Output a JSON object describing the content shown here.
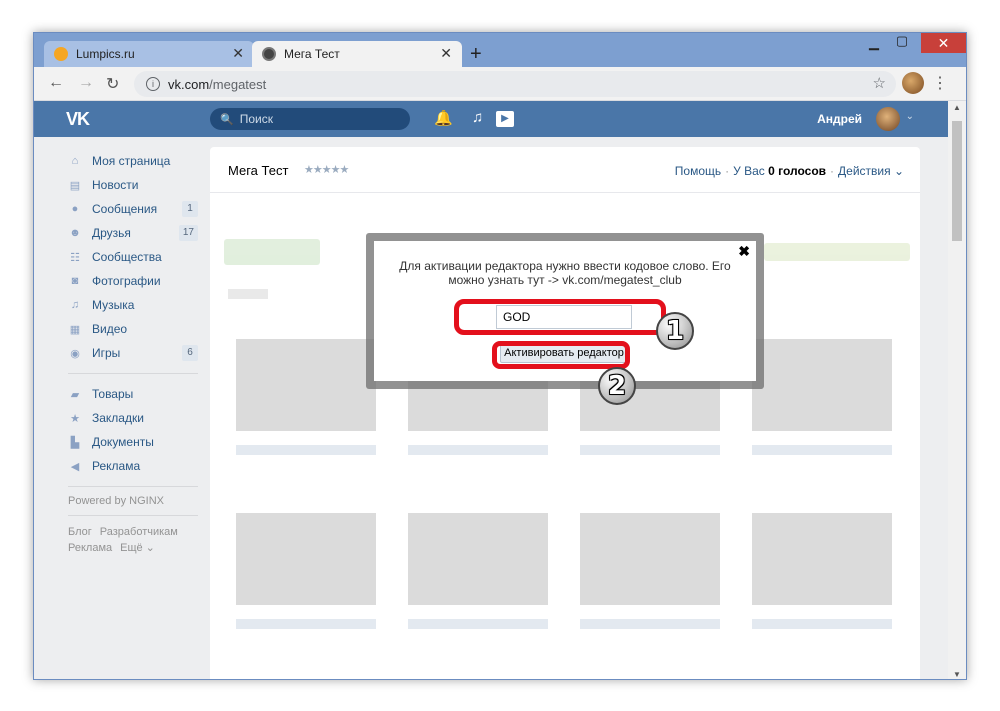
{
  "browser": {
    "tabs": [
      {
        "label": "Lumpics.ru",
        "favicon_color": "#f5a623"
      },
      {
        "label": "Мега Тест",
        "favicon_color": "#444444"
      }
    ],
    "address": {
      "host": "vk.com",
      "path": "/megatest"
    }
  },
  "vk": {
    "search_placeholder": "Поиск",
    "user_name": "Андрей",
    "nav": [
      {
        "label": "Моя страница",
        "icon": "home-icon",
        "count": ""
      },
      {
        "label": "Новости",
        "icon": "news-icon",
        "count": ""
      },
      {
        "label": "Сообщения",
        "icon": "messages-icon",
        "count": "1"
      },
      {
        "label": "Друзья",
        "icon": "friends-icon",
        "count": "17"
      },
      {
        "label": "Сообщества",
        "icon": "communities-icon",
        "count": ""
      },
      {
        "label": "Фотографии",
        "icon": "photos-icon",
        "count": ""
      },
      {
        "label": "Музыка",
        "icon": "music-icon",
        "count": ""
      },
      {
        "label": "Видео",
        "icon": "video-icon",
        "count": ""
      },
      {
        "label": "Игры",
        "icon": "games-icon",
        "count": "6"
      },
      {
        "label": "Товары",
        "icon": "goods-icon",
        "count": ""
      },
      {
        "label": "Закладки",
        "icon": "bookmarks-icon",
        "count": ""
      },
      {
        "label": "Документы",
        "icon": "documents-icon",
        "count": ""
      },
      {
        "label": "Реклама",
        "icon": "ads-icon",
        "count": ""
      }
    ],
    "powered_by": "Powered by NGINX",
    "footer_links": [
      "Блог",
      "Разработчикам",
      "Реклама",
      "Ещё ⌄"
    ]
  },
  "card": {
    "title": "Мега Тест",
    "stars": "★★★★★",
    "help": "Помощь",
    "votes_prefix": "У Вас",
    "votes_value": "0 голосов",
    "actions": "Действия ⌄"
  },
  "dialog": {
    "text": "Для активации редактора нужно ввести кодовое слово. Его можно узнать тут -> vk.com/megatest_club",
    "code_value": "GOD",
    "button_label": "Активировать редактор",
    "close": "✖"
  },
  "annotations": {
    "step1": "1",
    "step2": "2",
    "color": "#e3101c"
  }
}
